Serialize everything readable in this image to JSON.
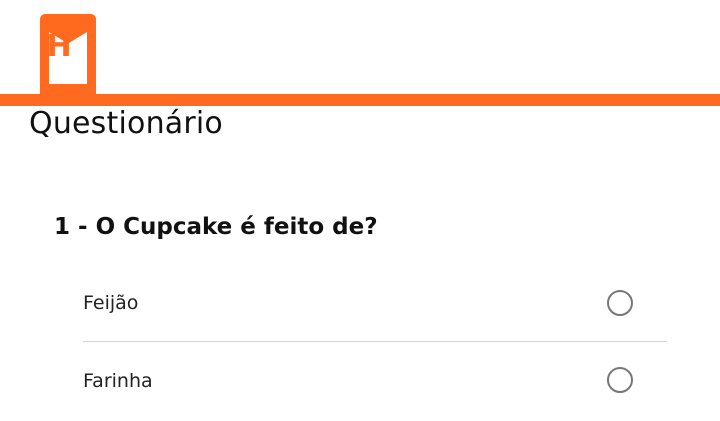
{
  "header": {
    "logo_letter": "H",
    "accent_color": "#ff6a1f"
  },
  "page": {
    "title": "Questionário"
  },
  "question": {
    "title": "1 - O Cupcake é feito de?",
    "options": [
      {
        "label": "Feijão",
        "selected": false
      },
      {
        "label": "Farinha",
        "selected": false
      }
    ]
  }
}
